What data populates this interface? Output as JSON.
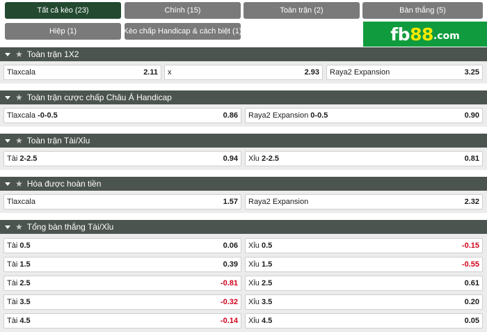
{
  "tabs": [
    {
      "label": "Tất cả kèo (23)",
      "active": true
    },
    {
      "label": "Chính (15)",
      "active": false
    },
    {
      "label": "Toàn trận (2)",
      "active": false
    },
    {
      "label": "Bàn thắng (5)",
      "active": false
    },
    {
      "label": "Hiệp (1)",
      "active": false
    },
    {
      "label": "Kèo chấp Handicap & cách biệt (1)",
      "active": false
    }
  ],
  "logo": {
    "part1": "fb",
    "part2": "88",
    "part3": ".com"
  },
  "sections": {
    "s1": {
      "title": "Toàn trận 1X2",
      "cells": [
        {
          "label": "Tlaxcala",
          "line": "",
          "odd": "2.11"
        },
        {
          "label": "x",
          "line": "",
          "odd": "2.93"
        },
        {
          "label": "Raya2 Expansion",
          "line": "",
          "odd": "3.25"
        }
      ]
    },
    "s2": {
      "title": "Toàn trận cược chấp Châu Á Handicap",
      "cells": [
        {
          "label": "Tlaxcala",
          "line": "-0-0.5",
          "odd": "0.86"
        },
        {
          "label": "Raya2 Expansion",
          "line": "0-0.5",
          "odd": "0.90"
        }
      ]
    },
    "s3": {
      "title": "Toàn trận Tài/Xỉu",
      "cells": [
        {
          "label": "Tài",
          "line": "2-2.5",
          "odd": "0.94"
        },
        {
          "label": "Xỉu",
          "line": "2-2.5",
          "odd": "0.81"
        }
      ]
    },
    "s4": {
      "title": "Hòa được hoàn tiền",
      "cells": [
        {
          "label": "Tlaxcala",
          "line": "",
          "odd": "1.57"
        },
        {
          "label": "Raya2 Expansion",
          "line": "",
          "odd": "2.32"
        }
      ]
    },
    "s5": {
      "title": "Tổng bàn thắng Tài/Xỉu",
      "rows": [
        {
          "over": {
            "label": "Tài",
            "line": "0.5",
            "odd": "0.06"
          },
          "under": {
            "label": "Xỉu",
            "line": "0.5",
            "odd": "-0.15"
          }
        },
        {
          "over": {
            "label": "Tài",
            "line": "1.5",
            "odd": "0.39"
          },
          "under": {
            "label": "Xỉu",
            "line": "1.5",
            "odd": "-0.55"
          }
        },
        {
          "over": {
            "label": "Tài",
            "line": "2.5",
            "odd": "-0.81"
          },
          "under": {
            "label": "Xỉu",
            "line": "2.5",
            "odd": "0.61"
          }
        },
        {
          "over": {
            "label": "Tài",
            "line": "3.5",
            "odd": "-0.32"
          },
          "under": {
            "label": "Xỉu",
            "line": "3.5",
            "odd": "0.20"
          }
        },
        {
          "over": {
            "label": "Tài",
            "line": "4.5",
            "odd": "-0.14"
          },
          "under": {
            "label": "Xỉu",
            "line": "4.5",
            "odd": "0.05"
          }
        }
      ]
    }
  },
  "colors": {
    "active_tab": "#234a30",
    "tab": "#7a7a7a",
    "section_header": "#4b544e",
    "logo_bg": "#109c3e",
    "logo_accent": "#f6e800",
    "negative_odd": "#d0021b"
  }
}
